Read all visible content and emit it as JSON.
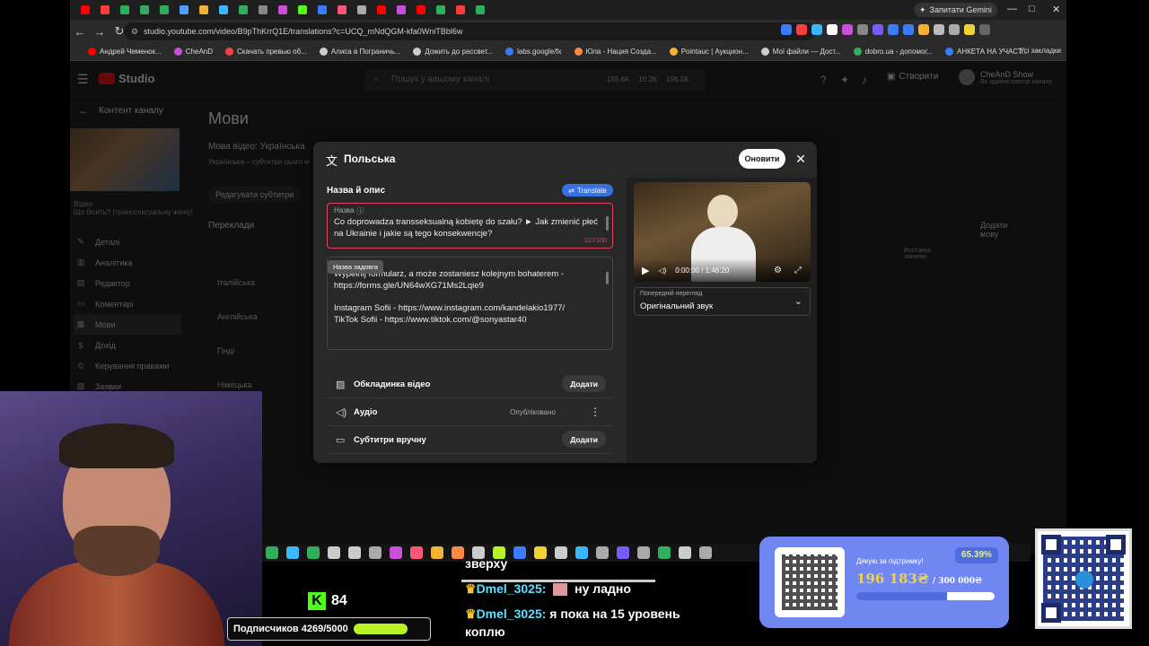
{
  "browser": {
    "url": "studio.youtube.com/video/B9pThKrrQ1E/translations?c=UCQ_mNdQGM-kfa0WniTBbl6w",
    "gemini_label": "Запитати Gemini",
    "bookmarks": [
      "Андрей Чеменок...",
      "CheAnD",
      "Скачать превью об...",
      "Алиса в Пограничь...",
      "Дожить до рассвет...",
      "labs.google/fx",
      "Юла - Нация Созда...",
      "Pointauc | Аукцион...",
      "Мої файли — Дост...",
      "dobro.ua - допомог...",
      "АНКЕТА НА УЧАСТ..."
    ],
    "all_bookmarks": "Усі закладки"
  },
  "studio": {
    "logo": "Studio",
    "search_placeholder": "Пошук у вашому каналі",
    "stats": [
      "155.6K",
      "10.2K",
      "196.5K"
    ],
    "create_label": "Створити",
    "channel_name": "CheAnD Show",
    "channel_sub": "Ви адміністратор каналу",
    "sidebar": {
      "back_title": "Контент каналу",
      "video_label": "Відео",
      "video_title": "Що бісить? (транссексуальну жінку)",
      "duration": "1:48:20",
      "items": [
        "Деталі",
        "Аналітика",
        "Редактор",
        "Коментарі",
        "Мови",
        "Дохід",
        "Керування правами",
        "Заявки"
      ]
    },
    "main": {
      "title": "Мови",
      "video_lang": "Мова відео: Українська",
      "subtitle": "Українська – субтитри цього м",
      "edit_subs": "Редагувати субтитри",
      "translations": "Переклади",
      "add_lang": "Додати мову",
      "col_modified": "Востаннє змінено",
      "rows": [
        "Італійська",
        "Англійська",
        "Гінді",
        "Німецька"
      ]
    }
  },
  "modal": {
    "title": "Польська",
    "update_label": "Оновити",
    "section_title": "Назва й опис",
    "translate_label": "Translate",
    "title_field": {
      "label": "Назва",
      "value": "Co doprowadza transseksualną kobietę do szału? ► Jak zmienić płeć na Ukrainie i jakie są tego konsekwencje?",
      "count": "107/100"
    },
    "desc_tooltip": "Назва задовга",
    "description_lines": [
      "Wypełnij formularz, a może zostaniesz kolejnym bohaterem -",
      "https://forms.gle/UN64wXG71Ms2Lqie9",
      "",
      "Instagram Sofii - https://www.instagram.com/kandelakio1977/",
      "TikTok Sofii - https://www.tiktok.com/@sonyastar40"
    ],
    "options": [
      {
        "label": "Обкладинка відео",
        "action": "Додати"
      },
      {
        "label": "Аудіо",
        "status": "Опубліковано"
      },
      {
        "label": "Субтитри вручну",
        "action": "Додати"
      }
    ],
    "video_time": "0:00:00 / 1:48:20",
    "preview_label": "Попередній перегляд",
    "preview_value": "Оригінальний звук"
  },
  "overlay": {
    "kick_viewers": "84",
    "subs_text": "Подписчиков 4269/5000",
    "subs_progress": 0.8538,
    "chat": [
      {
        "user": "",
        "text": "зверху"
      },
      {
        "user": "Dmel_3025:",
        "text": "ну ладно"
      },
      {
        "user": "Dmel_3025:",
        "text": "я пока на 15 уровень"
      },
      {
        "user": "",
        "text": "коплю"
      }
    ],
    "donate": {
      "thanks": "Дякую за підтримку!",
      "percent": "65.39%",
      "raised": "196 183₴",
      "goal": "/ 300 000₴",
      "progress": 0.6539
    }
  },
  "colors": {
    "accent_blue": "#3572e0",
    "error_red": "#e0455d",
    "kick_green": "#53fc18",
    "donate_bg": "#7086f0"
  }
}
